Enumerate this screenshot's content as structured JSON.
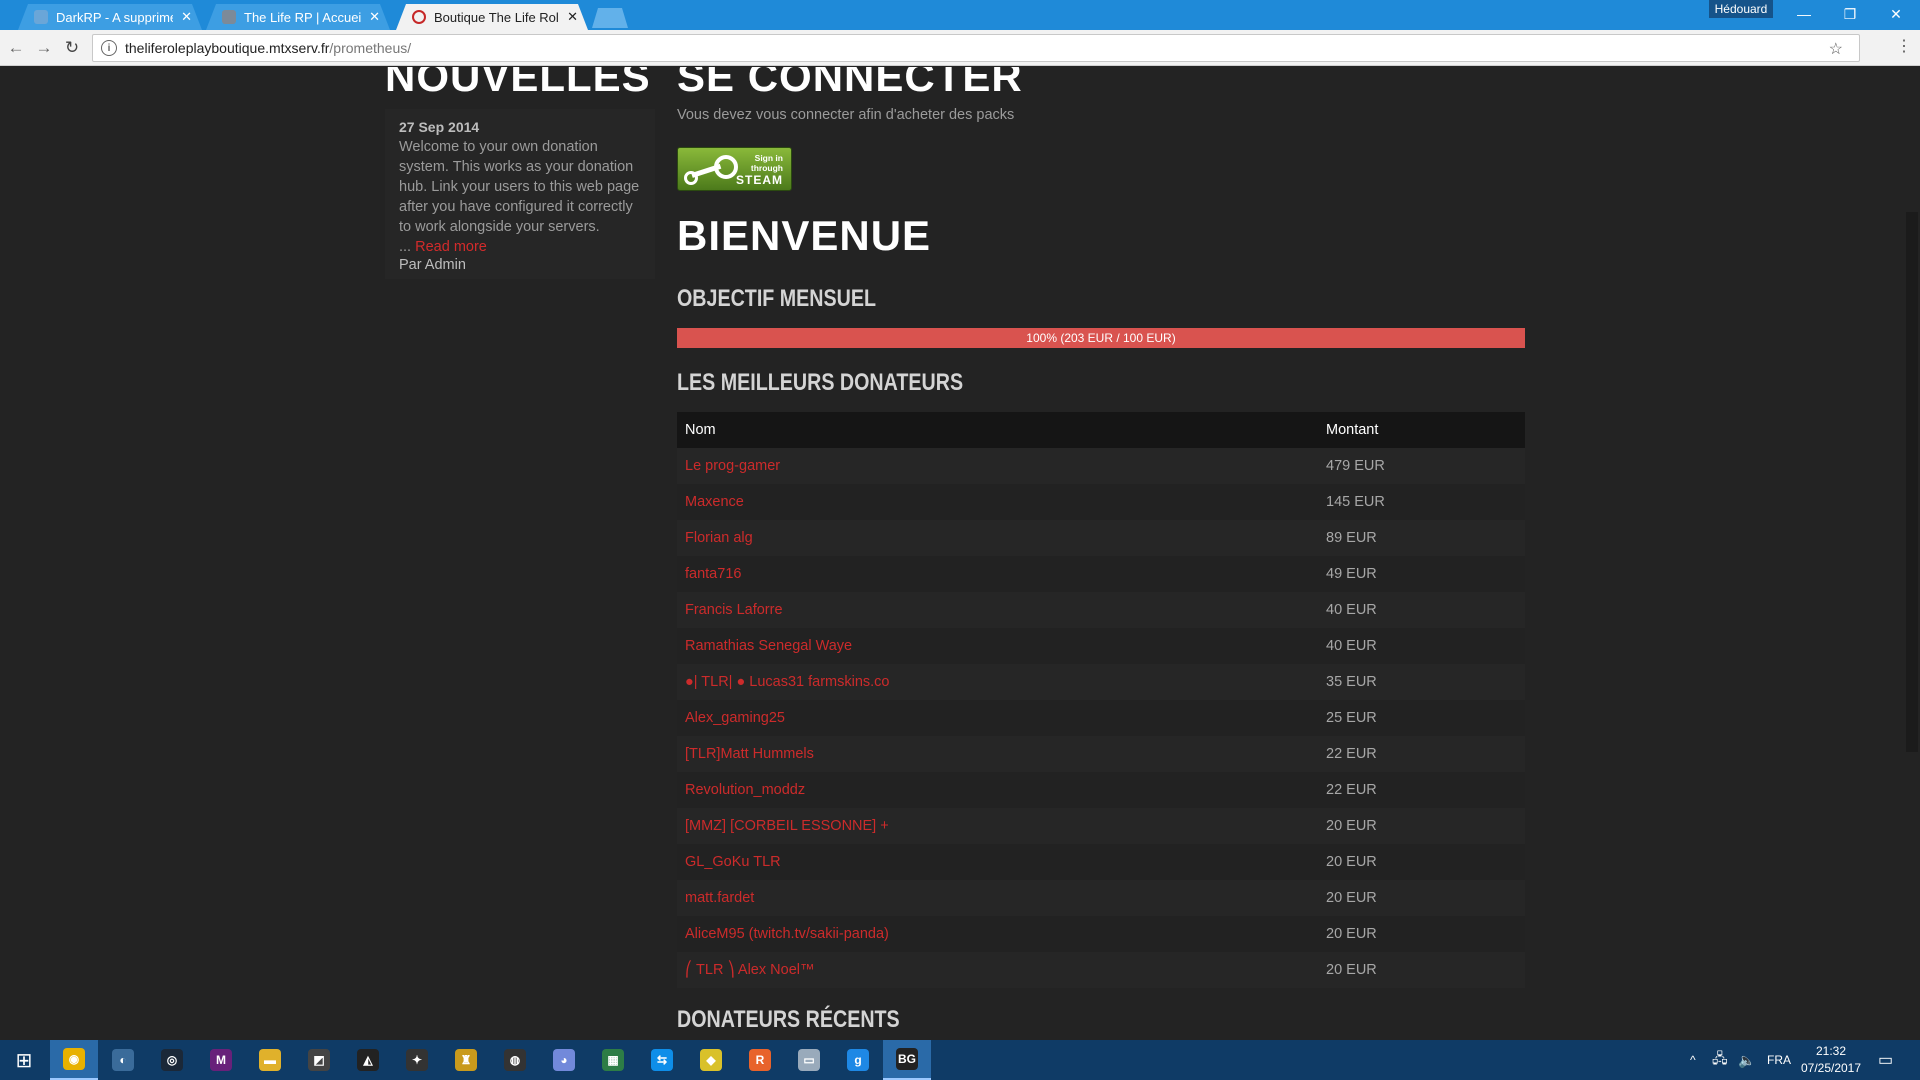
{
  "browser": {
    "tabs": [
      {
        "title": "DarkRP - A supprimer | F",
        "close": "✕",
        "favicon_color": "#6aa6d8",
        "active": false
      },
      {
        "title": "The Life RP | Accueil",
        "close": "✕",
        "favicon_color": "#7c8a99",
        "active": false
      },
      {
        "title": "Boutique The Life Rolepl",
        "close": "✕",
        "favicon_color": "#c62828",
        "active": true
      }
    ],
    "user": "Hédouard",
    "window_controls": {
      "minimize": "—",
      "maximize": "❐",
      "close": "✕"
    },
    "url_host": "theliferoleplayboutique.mtxserv.fr",
    "url_path": "/prometheus/",
    "info_icon": "i",
    "back_icon": "←",
    "forward_icon": "→",
    "reload_icon": "↻",
    "star_icon": "☆",
    "menu_icon": "⋮"
  },
  "news": {
    "heading": "NOUVELLES",
    "date": "27 Sep 2014",
    "body": "Welcome to your own donation system. This works as your donation hub. Link your users to this web page after you have configured it correctly to work alongside your servers.",
    "ellipsis": "... ",
    "read_more": "Read more",
    "author": "Par Admin"
  },
  "login": {
    "heading": "SE CONNECTER",
    "subtitle": "Vous devez vous connecter afin d'acheter des packs",
    "steam_small_1": "Sign in",
    "steam_small_2": "through",
    "steam_big": "STEAM"
  },
  "welcome": {
    "heading": "BIENVENUE",
    "goal_heading": "OBJECTIF MENSUEL",
    "goal_label": "100% (203 EUR / 100 EUR)",
    "goal_percent": 100
  },
  "top_donors": {
    "heading": "LES MEILLEURS DONATEURS",
    "col_name": "Nom",
    "col_amount": "Montant",
    "rows": [
      {
        "name": "Le prog-gamer",
        "amount": "479 EUR"
      },
      {
        "name": "Maxence",
        "amount": "145 EUR"
      },
      {
        "name": "Florian alg",
        "amount": "89 EUR"
      },
      {
        "name": "fanta716",
        "amount": "49 EUR"
      },
      {
        "name": "Francis Laforre",
        "amount": "40 EUR"
      },
      {
        "name": "Ramathias Senegal Waye",
        "amount": "40 EUR"
      },
      {
        "name": "●| TLR| ● Lucas31 farmskins.co",
        "amount": "35 EUR"
      },
      {
        "name": "Alex_gaming25",
        "amount": "25 EUR"
      },
      {
        "name": "[TLR]Matt Hummels",
        "amount": "22 EUR"
      },
      {
        "name": "Revolution_moddz",
        "amount": "22 EUR"
      },
      {
        "name": "[MMZ] [CORBEIL ESSONNE] +",
        "amount": "20 EUR"
      },
      {
        "name": "GL_GoKu TLR",
        "amount": "20 EUR"
      },
      {
        "name": "matt.fardet",
        "amount": "20 EUR"
      },
      {
        "name": "AliceM95 (twitch.tv/sakii-panda)",
        "amount": "20 EUR"
      },
      {
        "name": "⎛ TLR ⎞ Alex Noel™",
        "amount": "20 EUR"
      }
    ]
  },
  "recent_donors": {
    "heading": "DONATEURS RÉCENTS"
  },
  "taskbar": {
    "start_icon": "⊞",
    "apps": [
      {
        "name": "chrome",
        "glyph": "◉",
        "color": "#e8b100",
        "active": true
      },
      {
        "name": "app-2",
        "glyph": "◐",
        "color": "#3a6b9a",
        "active": false
      },
      {
        "name": "steam",
        "glyph": "◎",
        "color": "#1b2838",
        "active": false
      },
      {
        "name": "visual-studio",
        "glyph": "M",
        "color": "#68217a",
        "active": false
      },
      {
        "name": "file-explorer",
        "glyph": "▬",
        "color": "#e0b12b",
        "active": false
      },
      {
        "name": "app-6",
        "glyph": "◩",
        "color": "#444",
        "active": false
      },
      {
        "name": "unity",
        "glyph": "◭",
        "color": "#222",
        "active": false
      },
      {
        "name": "app-8",
        "glyph": "✦",
        "color": "#333",
        "active": false
      },
      {
        "name": "app-9",
        "glyph": "♜",
        "color": "#c99a1c",
        "active": false
      },
      {
        "name": "obs",
        "glyph": "◍",
        "color": "#333",
        "active": false
      },
      {
        "name": "discord",
        "glyph": "◕",
        "color": "#7289da",
        "active": false
      },
      {
        "name": "app-12",
        "glyph": "▦",
        "color": "#2d7d46",
        "active": false
      },
      {
        "name": "teamviewer",
        "glyph": "⇆",
        "color": "#0e8ee9",
        "active": false
      },
      {
        "name": "app-14",
        "glyph": "◆",
        "color": "#d9c12a",
        "active": false
      },
      {
        "name": "app-15",
        "glyph": "R",
        "color": "#e8632b",
        "active": false
      },
      {
        "name": "app-16",
        "glyph": "▭",
        "color": "#9ab",
        "active": false
      },
      {
        "name": "garrysmod",
        "glyph": "g",
        "color": "#1e88e5",
        "active": false
      },
      {
        "name": "app-bg",
        "glyph": "BG",
        "color": "#222",
        "active": true
      }
    ],
    "tray_chevron": "^",
    "language": "FRA",
    "time": "21:32",
    "date": "07/25/2017",
    "notification_icon": "▭"
  }
}
